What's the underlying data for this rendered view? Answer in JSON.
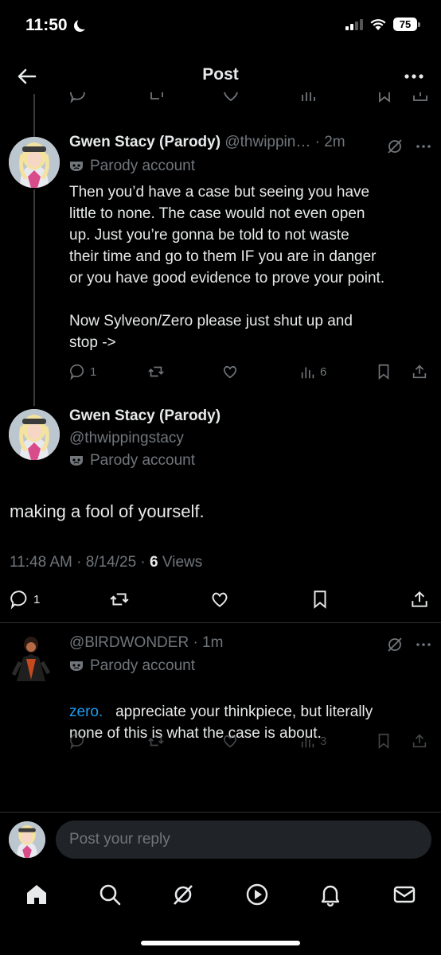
{
  "status_bar": {
    "time": "11:50",
    "battery": "75"
  },
  "header": {
    "title": "Post"
  },
  "reply_tweet": {
    "display_name": "Gwen Stacy (Parody)",
    "handle_time": "@thwippin… · 2m",
    "parody_label": "Parody account",
    "text": "Then you’d have a case but seeing you have\nlittle to none. The case would not even open\nup. Just you’re gonna be told to not waste\ntheir time and go to them IF you are in danger\nor you have good evidence to prove your point.\n\nNow Sylveon/Zero please just shut up and\nstop ->",
    "replies": "1",
    "views": "6"
  },
  "main_tweet": {
    "display_name": "Gwen Stacy (Parody)",
    "handle": "@thwippingstacy",
    "parody_label": "Parody account",
    "text": "making a fool of yourself.",
    "timestamp": "11:48 AM · 8/14/25 · ",
    "views_count": "6",
    "views_label": " Views",
    "replies": "1"
  },
  "bottom_reply": {
    "handle_time": "@BlRDWONDER · 1m",
    "parody_label": "Parody account",
    "mention": "zero.",
    "text_first": "appreciate your thinkpiece, but literally",
    "text_second": "none of this is what the case is about.",
    "views": "3"
  },
  "reply_composer": {
    "placeholder": "Post your reply"
  },
  "colors": {
    "accent": "#1d9bf0",
    "muted": "#71767b",
    "text": "#e7e9ea",
    "background": "#000000"
  }
}
